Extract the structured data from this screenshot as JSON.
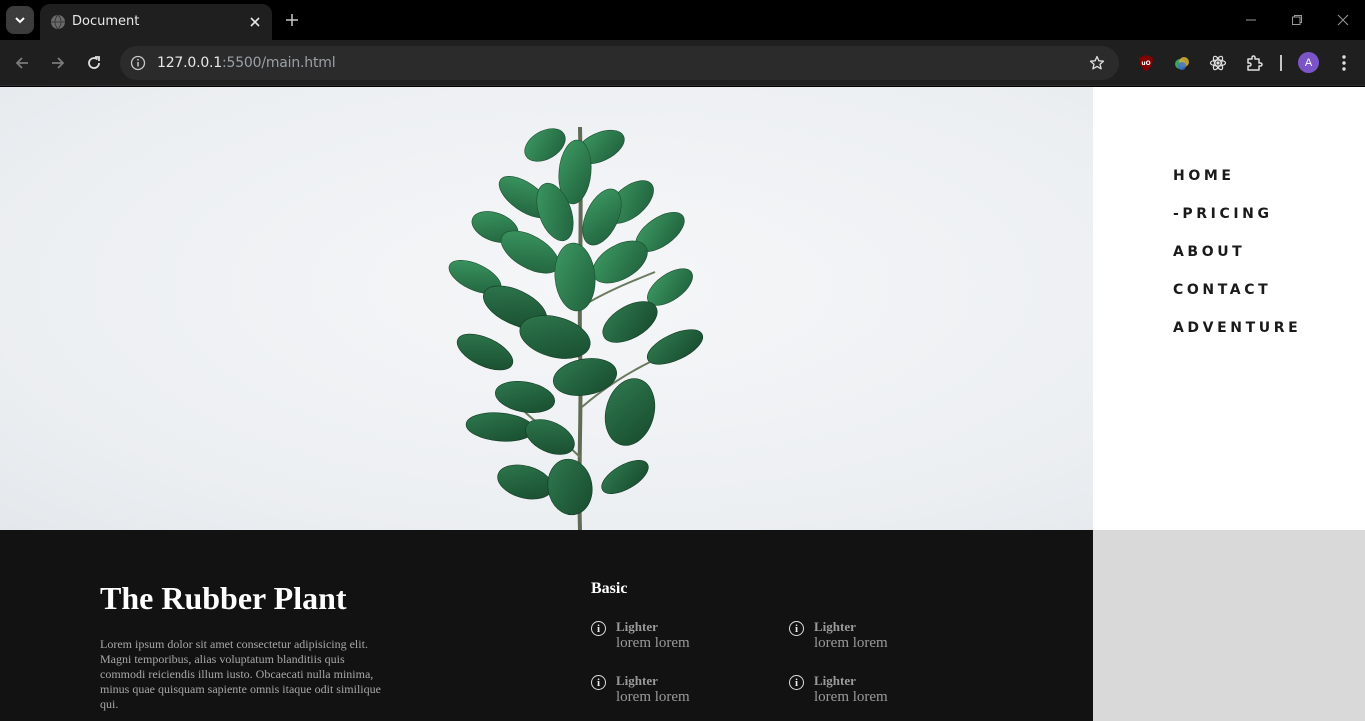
{
  "browser": {
    "tab_title": "Document",
    "url_host": "127.0.0.1",
    "url_path": ":5500/main.html",
    "avatar_letter": "A",
    "icons": [
      "tab-search-icon",
      "globe-icon",
      "close-icon",
      "plus-icon",
      "minimize-icon",
      "restore-icon",
      "back-arrow-icon",
      "forward-arrow-icon",
      "reload-icon",
      "info-icon",
      "star-icon",
      "ublock-icon",
      "color-extension-icon",
      "react-devtools-icon",
      "puzzle-icon",
      "more-vert-icon"
    ]
  },
  "nav": {
    "items": [
      "HOME",
      "-PRICING",
      "ABOUT",
      "CONTACT",
      "ADVENTURE"
    ]
  },
  "info": {
    "title": "The Rubber Plant",
    "description": "Lorem ipsum dolor sit amet consectetur adipisicing elit. Magni temporibus, alias voluptatum blanditiis quis commodi reiciendis illum iusto. Obcaecati nulla minima, minus quae quisquam sapiente omnis itaque odit similique qui.",
    "basic_title": "Basic",
    "features": [
      {
        "icon": "i",
        "label": "Lighter",
        "value": "lorem lorem"
      },
      {
        "icon": "i",
        "label": "Lighter",
        "value": "lorem lorem"
      },
      {
        "icon": "i",
        "label": "Lighter",
        "value": "lorem lorem"
      },
      {
        "icon": "i",
        "label": "Lighter",
        "value": "lorem lorem"
      }
    ]
  },
  "colors": {
    "info_bg": "#121212",
    "side_gray": "#d9d9d9",
    "leaf_green": "#2f7a4f"
  }
}
